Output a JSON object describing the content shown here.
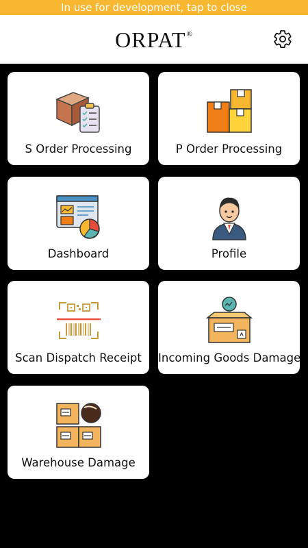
{
  "banner": {
    "text": "In use for development, tap to close"
  },
  "header": {
    "logo": "ORPAT",
    "logo_mark": "®",
    "settings_icon": "gear-icon"
  },
  "tiles": [
    {
      "label": "S Order Processing",
      "icon": "box-clipboard-icon"
    },
    {
      "label": "P Order Processing",
      "icon": "stacked-boxes-icon"
    },
    {
      "label": "Dashboard",
      "icon": "dashboard-chart-icon"
    },
    {
      "label": "Profile",
      "icon": "user-profile-icon"
    },
    {
      "label": "Scan Dispatch Receipt",
      "icon": "barcode-scan-icon"
    },
    {
      "label": "Incoming Goods Damage",
      "icon": "open-box-damage-icon"
    },
    {
      "label": "Warehouse Damage",
      "icon": "warehouse-boxes-icon"
    }
  ],
  "colors": {
    "banner": "#f7b731",
    "background": "#000000",
    "tile": "#ffffff"
  }
}
